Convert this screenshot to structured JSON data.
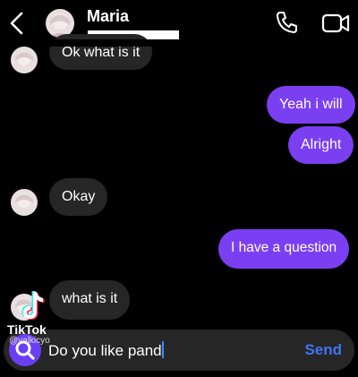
{
  "header": {
    "contact_name": "Maria"
  },
  "messages": [
    {
      "side": "in",
      "text": "Ok what is it"
    },
    {
      "side": "out",
      "text": "Yeah i will"
    },
    {
      "side": "out",
      "text": "Alright"
    },
    {
      "side": "in",
      "text": "Okay"
    },
    {
      "side": "out",
      "text": "I have a question"
    },
    {
      "side": "in",
      "text": "what is it"
    }
  ],
  "composer": {
    "value": "Do you like pand",
    "send_label": "Send"
  },
  "watermark": {
    "brand": "TikTok",
    "user": "@valkicyo"
  },
  "colors": {
    "outgoing": "#7b3ff2",
    "incoming": "#262626",
    "send": "#3f76f6"
  },
  "icons": [
    "back-arrow-icon",
    "phone-icon",
    "video-camera-icon",
    "search-icon",
    "tiktok-logo-icon"
  ]
}
